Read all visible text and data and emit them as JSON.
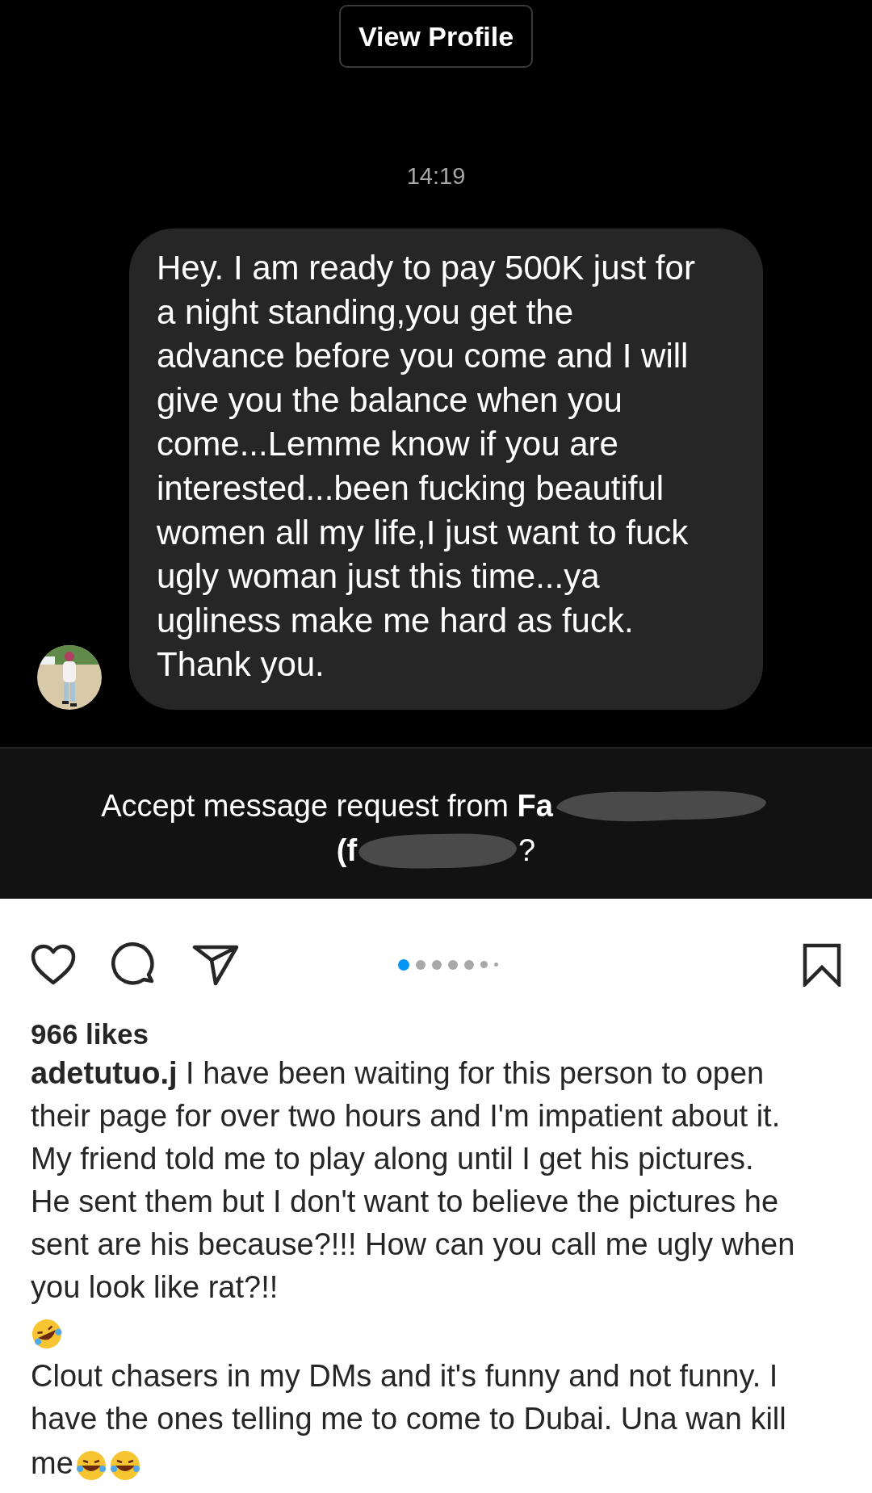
{
  "profile_button": {
    "label": "View Profile"
  },
  "timestamp": "14:19",
  "message": {
    "text": "Hey. I am ready to pay 500K just for\na night standing,you get the\nadvance before you come and I will\ngive you the balance when you\ncome...Lemme know if you are\ninterested...been fucking beautiful\nwomen all my life,I just want to fuck\nugly woman just this time...ya\nugliness make me hard as fuck.\nThank you."
  },
  "request": {
    "title": "Accept message request from **Fa**",
    "handle_start": "(f",
    "end": "?"
  },
  "post": {
    "carousel": [
      {
        "selected": true
      },
      {
        "selected": false
      },
      {
        "selected": false
      },
      {
        "selected": false
      },
      {
        "selected": false
      },
      {
        "selected": false
      },
      {
        "selected": false
      }
    ],
    "likes": "966 likes",
    "paragraphs": [
      [
        {
          "kind": "text",
          "text": "**adetutuo.j** I have been waiting for this person to open\ntheir page for over two hours and I'm impatient about it.\nMy friend told me to play along until I get his pictures.\nHe sent them but I don't want to believe the pictures he\nsent are his because?!!! How can you call me ugly when\nyou look like rat?!!"
        }
      ],
      [
        {
          "kind": "rofl"
        }
      ],
      [
        {
          "kind": "text",
          "text": "Clout chasers in my DMs and it's funny and not funny. I\nhave the ones telling me to come to Dubai. Una wan kill"
        }
      ],
      [
        {
          "kind": "text",
          "text": "me"
        },
        {
          "kind": "joy"
        },
        {
          "kind": "joy"
        }
      ]
    ]
  }
}
